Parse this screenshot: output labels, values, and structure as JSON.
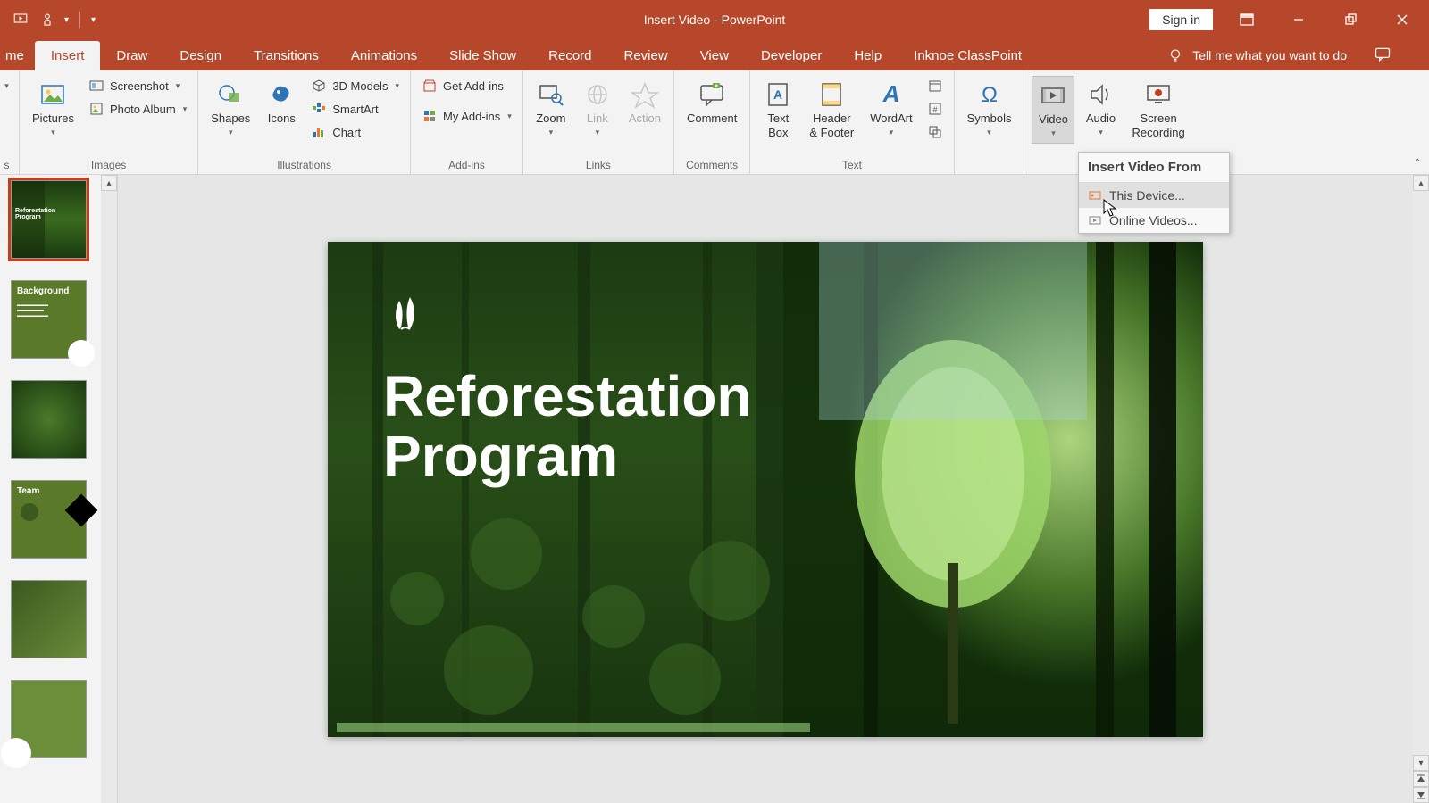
{
  "titlebar": {
    "title": "Insert Video  -  PowerPoint",
    "signin": "Sign in"
  },
  "tabs": {
    "partial_home": "me",
    "items": [
      "Insert",
      "Draw",
      "Design",
      "Transitions",
      "Animations",
      "Slide Show",
      "Record",
      "Review",
      "View",
      "Developer",
      "Help",
      "Inknoe ClassPoint"
    ],
    "active": "Insert",
    "tellme": "Tell me what you want to do"
  },
  "ribbon": {
    "images": {
      "label": "Images",
      "pictures": "Pictures",
      "screenshot": "Screenshot",
      "photo_album": "Photo Album"
    },
    "illustrations": {
      "label": "Illustrations",
      "shapes": "Shapes",
      "icons": "Icons",
      "models3d": "3D Models",
      "smartart": "SmartArt",
      "chart": "Chart"
    },
    "addins": {
      "label": "Add-ins",
      "get": "Get Add-ins",
      "my": "My Add-ins"
    },
    "links": {
      "label": "Links",
      "zoom": "Zoom",
      "link": "Link",
      "action": "Action"
    },
    "comments": {
      "label": "Comments",
      "comment": "Comment"
    },
    "text": {
      "label": "Text",
      "textbox": "Text\nBox",
      "headfoot": "Header\n& Footer",
      "wordart": "WordArt"
    },
    "symbols": {
      "label": "",
      "symbols": "Symbols"
    },
    "media": {
      "label": "",
      "video": "Video",
      "audio": "Audio",
      "screenrec": "Screen\nRecording"
    }
  },
  "video_menu": {
    "header": "Insert Video From",
    "this_device": "This Device...",
    "online": "Online Videos..."
  },
  "slide": {
    "title": "Reforestation\nProgram"
  },
  "thumbs": {
    "t2": "Background",
    "t4": "Team"
  }
}
